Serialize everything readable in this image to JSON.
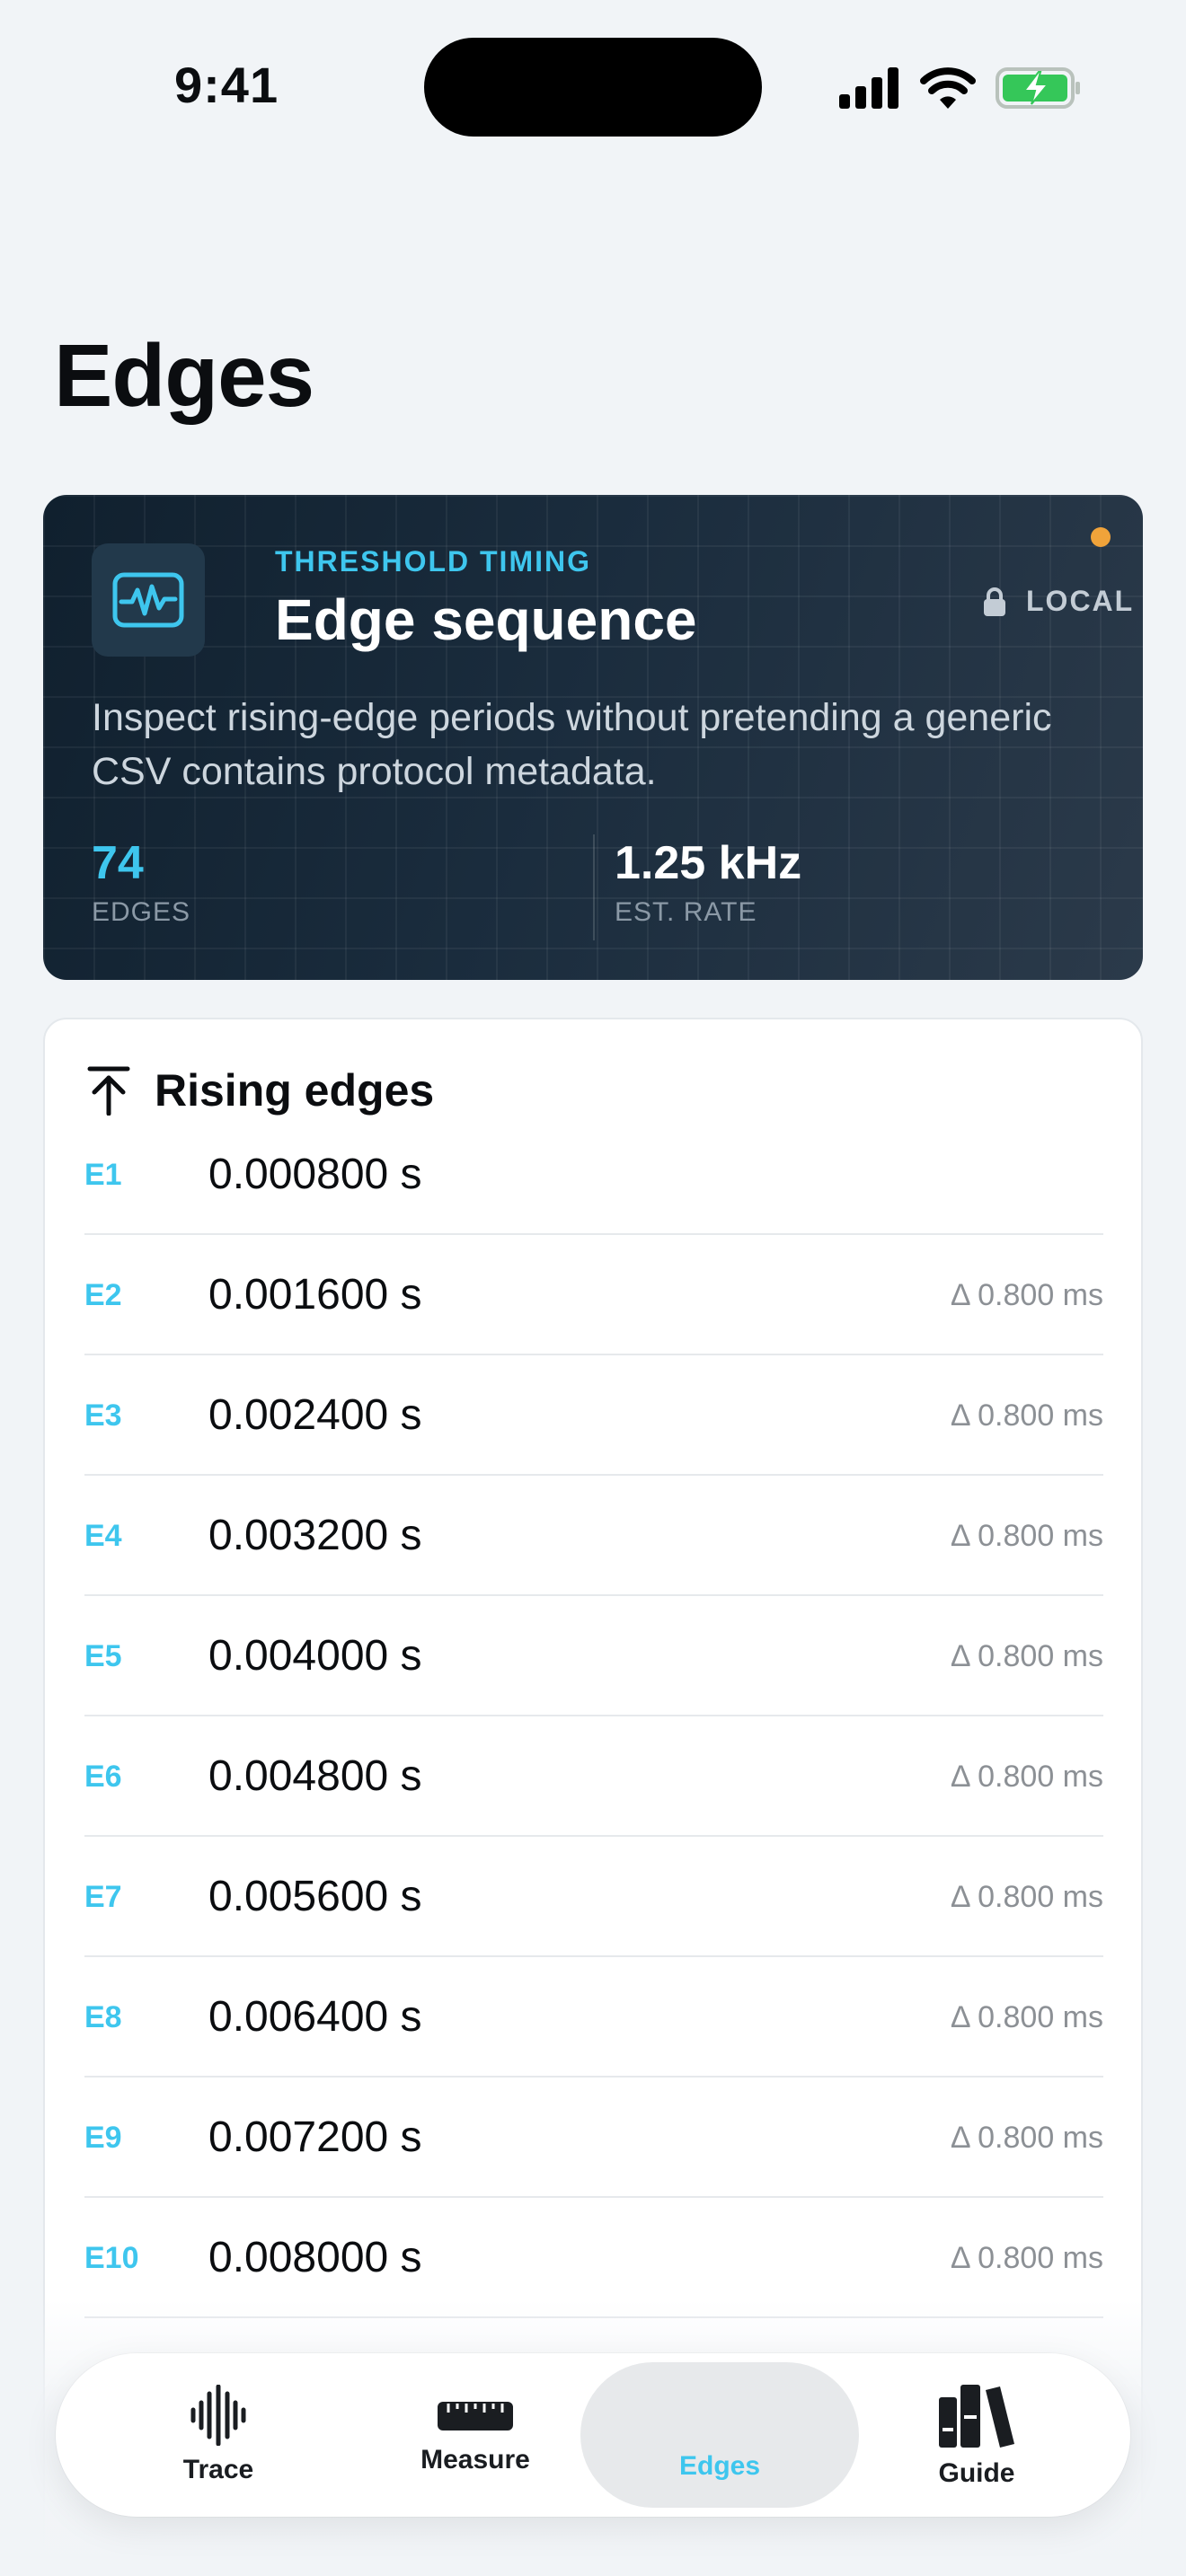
{
  "status_bar": {
    "time": "9:41"
  },
  "page": {
    "title": "Edges"
  },
  "hero": {
    "eyebrow": "THRESHOLD TIMING",
    "title": "Edge sequence",
    "badge": "LOCAL",
    "description": "Inspect rising-edge periods without pretending a generic CSV contains protocol metadata.",
    "stats": [
      {
        "value": "74",
        "label": "EDGES"
      },
      {
        "value": "1.25 kHz",
        "label": "EST. RATE"
      }
    ],
    "icon": "waveform-icon",
    "colors": {
      "accent": "#3ec6ee",
      "status_dot": "#f0a33a"
    }
  },
  "edges_list": {
    "title": "Rising edges",
    "icon": "arrow-up-to-line-icon",
    "rows": [
      {
        "id": "E1",
        "time": "0.000800 s",
        "delta": ""
      },
      {
        "id": "E2",
        "time": "0.001600 s",
        "delta": "Δ 0.800 ms"
      },
      {
        "id": "E3",
        "time": "0.002400 s",
        "delta": "Δ 0.800 ms"
      },
      {
        "id": "E4",
        "time": "0.003200 s",
        "delta": "Δ 0.800 ms"
      },
      {
        "id": "E5",
        "time": "0.004000 s",
        "delta": "Δ 0.800 ms"
      },
      {
        "id": "E6",
        "time": "0.004800 s",
        "delta": "Δ 0.800 ms"
      },
      {
        "id": "E7",
        "time": "0.005600 s",
        "delta": "Δ 0.800 ms"
      },
      {
        "id": "E8",
        "time": "0.006400 s",
        "delta": "Δ 0.800 ms"
      },
      {
        "id": "E9",
        "time": "0.007200 s",
        "delta": "Δ 0.800 ms"
      },
      {
        "id": "E10",
        "time": "0.008000 s",
        "delta": "Δ 0.800 ms"
      }
    ]
  },
  "tab_bar": {
    "tabs": [
      {
        "label": "Trace",
        "icon": "waveform-bars-icon",
        "active": false
      },
      {
        "label": "Measure",
        "icon": "ruler-icon",
        "active": false
      },
      {
        "label": "Edges",
        "icon": "",
        "active": true
      },
      {
        "label": "Guide",
        "icon": "books-icon",
        "active": false
      }
    ]
  }
}
